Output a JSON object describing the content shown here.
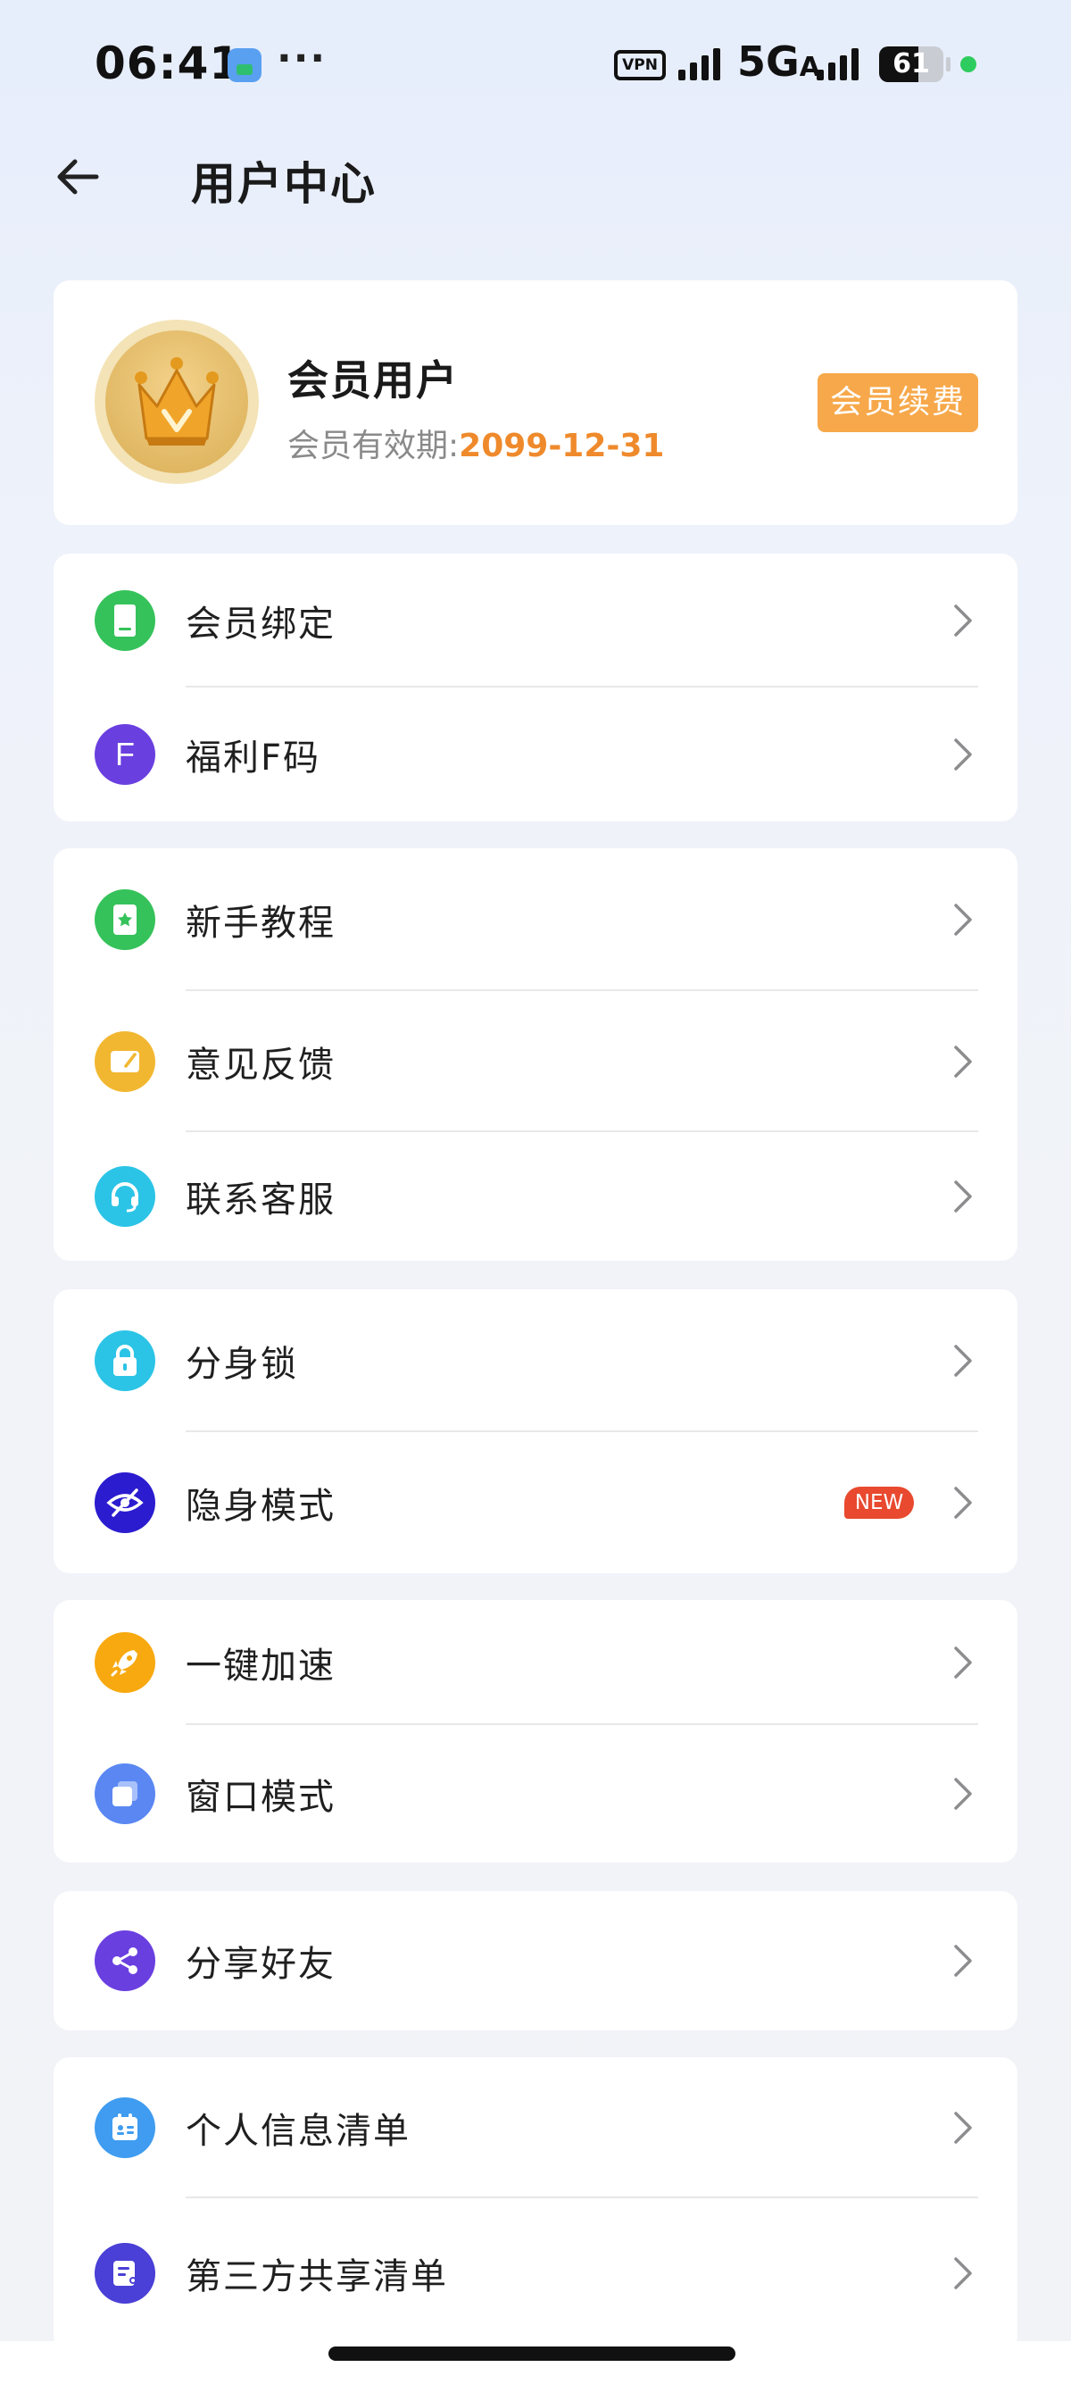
{
  "status_bar": {
    "time": "06:41",
    "overflow": "···",
    "vpn": "VPN",
    "network": "5G",
    "network_sub": "A",
    "battery": "61",
    "battery_level": 0.61
  },
  "header": {
    "title": "用户中心",
    "back_icon": "arrow-left-icon"
  },
  "profile": {
    "name": "会员用户",
    "validity_label": "会员有效期:",
    "validity_date": "2099-12-31",
    "renew_label": "会员续费",
    "avatar_icon": "crown-icon"
  },
  "groups": [
    {
      "items": [
        {
          "label": "会员绑定",
          "icon": "phone-icon",
          "color": "#35c25a"
        },
        {
          "label": "福利F码",
          "icon": "letter-f-icon",
          "color": "#6a3fe0"
        }
      ]
    },
    {
      "items": [
        {
          "label": "新手教程",
          "icon": "guide-book-icon",
          "color": "#35c25a"
        },
        {
          "label": "意见反馈",
          "icon": "feedback-icon",
          "color": "#f2b731"
        },
        {
          "label": "联系客服",
          "icon": "headset-icon",
          "color": "#2bc4e6"
        }
      ]
    },
    {
      "items": [
        {
          "label": "分身锁",
          "icon": "lock-icon",
          "color": "#2bc4e6"
        },
        {
          "label": "隐身模式",
          "icon": "eye-off-icon",
          "color": "#2b1ccf",
          "badge": "NEW"
        }
      ]
    },
    {
      "items": [
        {
          "label": "一键加速",
          "icon": "rocket-icon",
          "color": "#f7a90f"
        },
        {
          "label": "窗口模式",
          "icon": "window-icon",
          "color": "#5a87f2"
        }
      ]
    },
    {
      "items": [
        {
          "label": "分享好友",
          "icon": "share-icon",
          "color": "#6a3fe0"
        }
      ]
    },
    {
      "items": [
        {
          "label": "个人信息清单",
          "icon": "id-card-icon",
          "color": "#3f9cf0"
        },
        {
          "label": "第三方共享清单",
          "icon": "list-share-icon",
          "color": "#4a3fd6"
        }
      ]
    }
  ]
}
